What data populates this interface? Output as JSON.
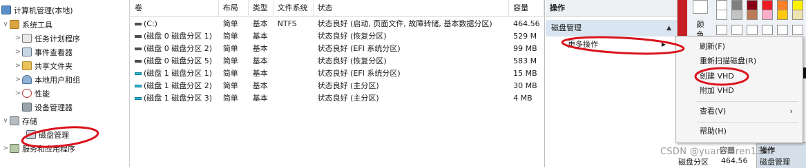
{
  "tree": {
    "items": [
      {
        "label": "计算机管理(本地)",
        "icon": "computer-icon",
        "twisty": ""
      },
      {
        "label": "系统工具",
        "icon": "tools-icon",
        "twisty": "∨"
      },
      {
        "label": "任务计划程序",
        "icon": "task-scheduler-icon",
        "twisty": ">"
      },
      {
        "label": "事件查看器",
        "icon": "event-viewer-icon",
        "twisty": ">"
      },
      {
        "label": "共享文件夹",
        "icon": "shared-folders-icon",
        "twisty": ">"
      },
      {
        "label": "本地用户和组",
        "icon": "users-icon",
        "twisty": ">"
      },
      {
        "label": "性能",
        "icon": "performance-icon",
        "twisty": ">"
      },
      {
        "label": "设备管理器",
        "icon": "device-manager-icon",
        "twisty": ""
      },
      {
        "label": "存储",
        "icon": "storage-icon",
        "twisty": "∨"
      },
      {
        "label": "磁盘管理",
        "icon": "disk-management-icon",
        "twisty": ""
      },
      {
        "label": "服务和应用程序",
        "icon": "services-icon",
        "twisty": ">"
      }
    ]
  },
  "volumes": {
    "headers": [
      "卷",
      "布局",
      "类型",
      "文件系统",
      "状态",
      "容量"
    ],
    "rows": [
      {
        "vol": "(C:)",
        "layout": "简单",
        "type": "基本",
        "fs": "NTFS",
        "status": "状态良好 (启动, 页面文件, 故障转储, 基本数据分区)",
        "cap": "464.56",
        "disk": "gray"
      },
      {
        "vol": "(磁盘 0 磁盘分区 1)",
        "layout": "简单",
        "type": "基本",
        "fs": "",
        "status": "状态良好 (恢复分区)",
        "cap": "529 M",
        "disk": "gray"
      },
      {
        "vol": "(磁盘 0 磁盘分区 2)",
        "layout": "简单",
        "type": "基本",
        "fs": "",
        "status": "状态良好 (EFI 系统分区)",
        "cap": "99 MB",
        "disk": "gray"
      },
      {
        "vol": "(磁盘 0 磁盘分区 5)",
        "layout": "简单",
        "type": "基本",
        "fs": "",
        "status": "状态良好 (恢复分区)",
        "cap": "583 M",
        "disk": "gray"
      },
      {
        "vol": "(磁盘 1 磁盘分区 1)",
        "layout": "简单",
        "type": "基本",
        "fs": "",
        "status": "状态良好 (EFI 系统分区)",
        "cap": "15 MB",
        "disk": "cyan"
      },
      {
        "vol": "(磁盘 1 磁盘分区 2)",
        "layout": "简单",
        "type": "基本",
        "fs": "",
        "status": "状态良好 (主分区)",
        "cap": "30 MB",
        "disk": "cyan"
      },
      {
        "vol": "(磁盘 1 磁盘分区 3)",
        "layout": "简单",
        "type": "基本",
        "fs": "",
        "status": "状态良好 (主分区)",
        "cap": "4 MB",
        "disk": "cyan"
      }
    ]
  },
  "actions": {
    "title": "操作",
    "section": "磁盘管理",
    "more": "更多操作"
  },
  "context_menu": {
    "items": [
      "刷新(F)",
      "重新扫描磁盘(R)",
      "创建 VHD",
      "附加 VHD",
      "查看(V)",
      "帮助(H)"
    ]
  },
  "paint": {
    "color_label": "颜色 2",
    "swatches": [
      "#ffffff",
      "#c3c3c3",
      "#b97a57",
      "#ffaec9",
      "#ffc90e",
      "#efe4b0",
      "#b5e61d"
    ]
  },
  "status_strip": {
    "capacity_header": "容量",
    "capacity_value": "464.56",
    "action_header": "操作",
    "disk_label": "磁盘管理",
    "part_label": "磁盘分区"
  },
  "watermark": "CSDN @yuanshiren133",
  "colors": {
    "annotation": "#d9141c",
    "selection": "#d9e5f1"
  }
}
